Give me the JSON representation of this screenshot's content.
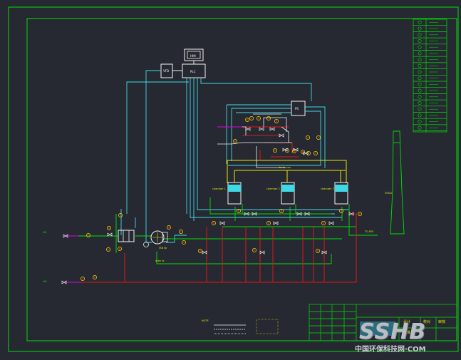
{
  "drawing": {
    "control_boxes": {
      "hmi": "HMI",
      "plc": "PLC",
      "vfd": "VFD",
      "ps": "PS",
      "ing": "INGN"
    },
    "chambers": [
      "chamber 1",
      "chamber 2",
      "chamber 3"
    ],
    "labels": {
      "ng_inlet": "NG",
      "air_inlet": "AIR",
      "to_burner": "to burner",
      "fan_label": "FAN for",
      "stack": "STACK",
      "vent": "TO ATM",
      "drain": "drain to",
      "legend_title": "NOTE"
    },
    "title_block": {
      "cells": [
        "设计",
        "校对",
        "审核",
        "批准"
      ]
    }
  },
  "watermark": {
    "big": "SSHB",
    "small": "中国环保科技网·COM"
  },
  "colors": {
    "bg": "#262932",
    "frame": "#00e000",
    "cyan": "#3fd9e6",
    "red": "#e01818",
    "yellow": "#e8e800",
    "white": "#f2f2f2",
    "magenta": "#e000e0"
  }
}
